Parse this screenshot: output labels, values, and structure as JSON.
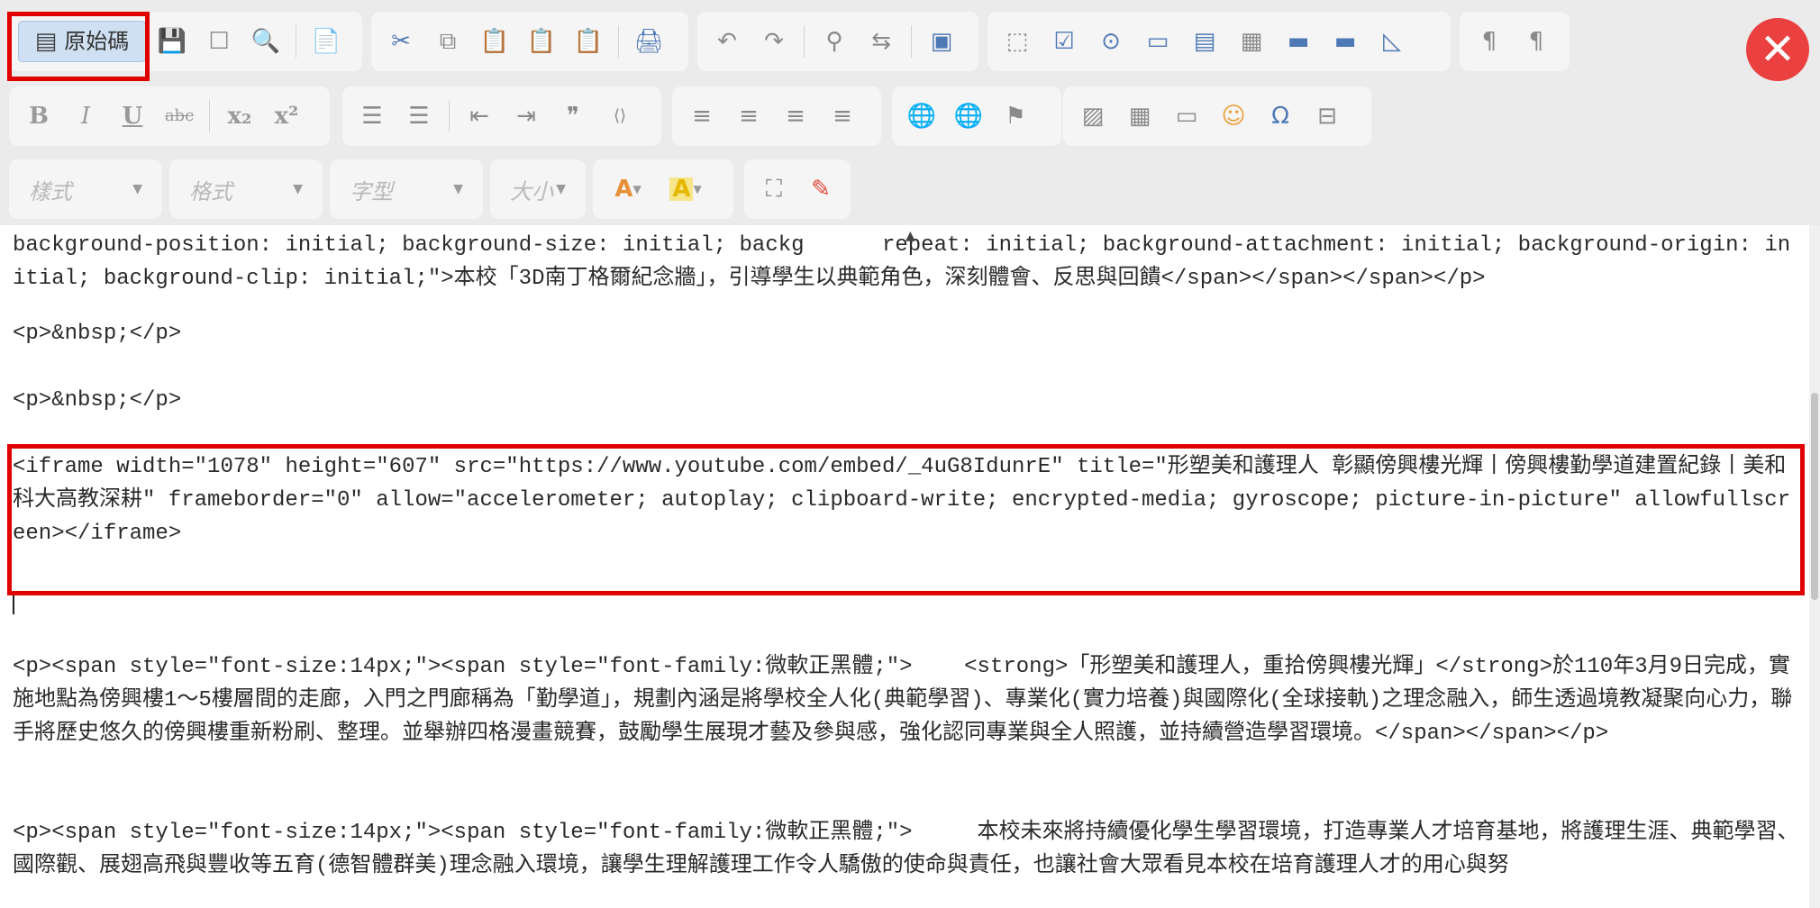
{
  "toolbar": {
    "source_button_label": "原始碼",
    "row1": [
      {
        "name": "save-icon",
        "glyph": "💾"
      },
      {
        "name": "new-page-icon",
        "glyph": "☐"
      },
      {
        "name": "preview-icon",
        "glyph": "🔍"
      },
      {
        "name": "templates-icon",
        "glyph": "📄"
      },
      {
        "name": "cut-icon",
        "glyph": "✂"
      },
      {
        "name": "copy-icon",
        "glyph": "⧉"
      },
      {
        "name": "paste-icon",
        "glyph": "📋"
      },
      {
        "name": "paste-text-icon",
        "glyph": "📋"
      },
      {
        "name": "paste-word-icon",
        "glyph": "📋"
      },
      {
        "name": "print-icon",
        "glyph": "🖨"
      },
      {
        "name": "undo-icon",
        "glyph": "↶"
      },
      {
        "name": "redo-icon",
        "glyph": "↷"
      },
      {
        "name": "find-icon",
        "glyph": "⚲"
      },
      {
        "name": "replace-icon",
        "glyph": "⇆"
      },
      {
        "name": "select-all-icon",
        "glyph": "▣"
      },
      {
        "name": "form-icon",
        "glyph": "⬚"
      },
      {
        "name": "checkbox-icon",
        "glyph": "☑"
      },
      {
        "name": "radio-icon",
        "glyph": "⊙"
      },
      {
        "name": "text-field-icon",
        "glyph": "▭"
      },
      {
        "name": "textarea-icon",
        "glyph": "▤"
      },
      {
        "name": "select-field-icon",
        "glyph": "▦"
      },
      {
        "name": "button-field-icon",
        "glyph": "▬"
      },
      {
        "name": "image-button-icon",
        "glyph": "▬"
      },
      {
        "name": "hidden-field-icon",
        "glyph": "◺"
      },
      {
        "name": "ltr-icon",
        "glyph": "¶"
      },
      {
        "name": "rtl-icon",
        "glyph": "¶"
      }
    ],
    "row2": [
      {
        "name": "bold-icon",
        "glyph": "B"
      },
      {
        "name": "italic-icon",
        "glyph": "I"
      },
      {
        "name": "underline-icon",
        "glyph": "U"
      },
      {
        "name": "strikethrough-icon",
        "glyph": "abc"
      },
      {
        "name": "subscript-icon",
        "glyph": "x₂"
      },
      {
        "name": "superscript-icon",
        "glyph": "x²"
      },
      {
        "name": "numbered-list-icon",
        "glyph": "☰"
      },
      {
        "name": "bulleted-list-icon",
        "glyph": "☰"
      },
      {
        "name": "outdent-icon",
        "glyph": "⇤"
      },
      {
        "name": "indent-icon",
        "glyph": "⇥"
      },
      {
        "name": "blockquote-icon",
        "glyph": "❞"
      },
      {
        "name": "div-icon",
        "glyph": "⟨⟩"
      },
      {
        "name": "align-left-icon",
        "glyph": "≡"
      },
      {
        "name": "align-center-icon",
        "glyph": "≡"
      },
      {
        "name": "align-right-icon",
        "glyph": "≡"
      },
      {
        "name": "align-justify-icon",
        "glyph": "≡"
      },
      {
        "name": "link-icon",
        "glyph": "🌐"
      },
      {
        "name": "unlink-icon",
        "glyph": "🌐"
      },
      {
        "name": "anchor-icon",
        "glyph": "⚑"
      },
      {
        "name": "image-icon",
        "glyph": "▨"
      },
      {
        "name": "table-icon",
        "glyph": "▦"
      },
      {
        "name": "horizontal-rule-icon",
        "glyph": "▭"
      },
      {
        "name": "smiley-icon",
        "glyph": "☺"
      },
      {
        "name": "special-char-icon",
        "glyph": "Ω"
      },
      {
        "name": "page-break-icon",
        "glyph": "⊟"
      }
    ],
    "row3": {
      "style_placeholder": "樣式",
      "format_placeholder": "格式",
      "font_placeholder": "字型",
      "size_placeholder": "大小",
      "text_color_glyph": "A",
      "bg_color_glyph": "A",
      "maximize_glyph": "⛶",
      "format_painter_glyph": "✎"
    },
    "close_glyph": "✕"
  },
  "source_code": {
    "line1": "background-position: initial; background-size: initial; backg      repeat: initial; background-attachment: initial; background-origin: initial; background-clip: initial;\">本校「3D南丁格爾紀念牆」，引導學生以典範角色，深刻體會、反思與回饋</span></span></span></p>",
    "line2": "<p>&nbsp;</p>",
    "line3": "<p>&nbsp;</p>",
    "iframe": "<iframe width=\"1078\" height=\"607\" src=\"https://www.youtube.com/embed/_4uG8IdunrE\" title=\"形塑美和護理人 彰顯傍興樓光輝丨傍興樓勤學道建置紀錄丨美和科大高教深耕\" frameborder=\"0\" allow=\"accelerometer; autoplay; clipboard-write; encrypted-media; gyroscope; picture-in-picture\" allowfullscreen></iframe>",
    "para1": "<p><span style=\"font-size:14px;\"><span style=\"font-family:微軟正黑體;\">    <strong>「形塑美和護理人，重拾傍興樓光輝」</strong>於110年3月9日完成，實施地點為傍興樓1～5樓層間的走廊，入門之門廊稱為「勤學道」，規劃內涵是將學校全人化(典範學習)、專業化(實力培養)與國際化(全球接軌)之理念融入，師生透過境教凝聚向心力，聯手將歷史悠久的傍興樓重新粉刷、整理。並舉辦四格漫畫競賽，鼓勵學生展現才藝及參與感，強化認同專業與全人照護，並持續營造學習環境。</span></span></p>",
    "para2": "<p><span style=\"font-size:14px;\"><span style=\"font-family:微軟正黑體;\">     本校未來將持續優化學生學習環境，打造專業人才培育基地，將護理生涯、典範學習、國際觀、展翅高飛與豐收等五育(德智體群美)理念融入環境，讓學生理解護理工作令人驕傲的使命與責任，也讓社會大眾看見本校在培育護理人才的用心與努"
  },
  "colors": {
    "highlight_border": "#e00000",
    "close_button": "#ea4040",
    "toolbar_background": "#ebebeb"
  }
}
